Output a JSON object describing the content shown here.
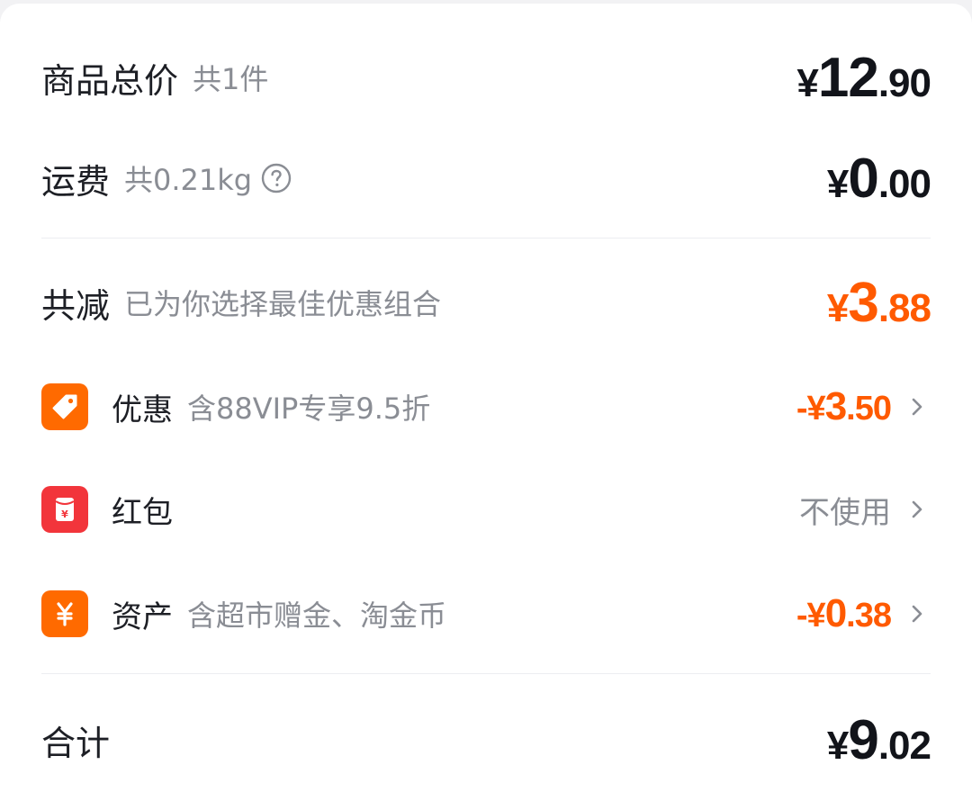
{
  "subtotal": {
    "label": "商品总价",
    "sub": "共1件",
    "symbol": "¥",
    "int": "12",
    "dec": ".90"
  },
  "shipping": {
    "label": "运费",
    "sub": "共0.21kg",
    "icon": "question-circle-icon",
    "symbol": "¥",
    "int": "0",
    "dec": ".00"
  },
  "total_discount": {
    "label": "共减",
    "sub": "已为你选择最佳优惠组合",
    "symbol": "¥",
    "int": "3",
    "dec": ".88"
  },
  "discount_items": [
    {
      "label": "优惠",
      "sub": "含88VIP专享9.5折",
      "icon": "tag-icon",
      "icon_color": "#ff6a00",
      "prefix": "-¥",
      "int": "3",
      "dec": ".50"
    },
    {
      "label": "红包",
      "sub": "",
      "icon": "red-envelope-icon",
      "icon_color": "#f2353b",
      "value": "不使用"
    },
    {
      "label": "资产",
      "sub": "含超市赠金、淘金币",
      "icon": "yen-icon",
      "icon_color": "#ff6a00",
      "prefix": "-¥",
      "int": "0",
      "dec": ".38"
    }
  ],
  "grand_total": {
    "label": "合计",
    "symbol": "¥",
    "int": "9",
    "dec": ".02"
  },
  "colors": {
    "accent": "#ff5a00",
    "text": "#12141a",
    "muted": "#8a8d94"
  }
}
